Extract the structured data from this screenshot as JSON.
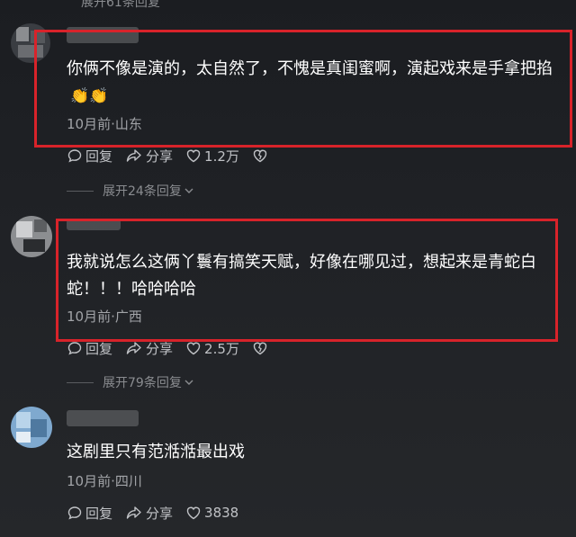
{
  "top_expand": {
    "label": "展开61条回复"
  },
  "comments": [
    {
      "text": "你俩不像是演的，太自然了，不愧是真闺蜜啊，演起戏来是手拿把掐",
      "emoji": "👏👏",
      "meta": "10月前·山东",
      "reply_label": "回复",
      "share_label": "分享",
      "likes": "1.2万",
      "expand_label": "展开24条回复"
    },
    {
      "text": "我就说怎么这俩丫鬟有搞笑天赋，好像在哪见过，想起来是青蛇白蛇！！！哈哈哈哈",
      "meta": "10月前·广西",
      "reply_label": "回复",
      "share_label": "分享",
      "likes": "2.5万",
      "expand_label": "展开79条回复"
    },
    {
      "text": "这剧里只有范湉湉最出戏",
      "meta": "10月前·四川",
      "reply_label": "回复",
      "share_label": "分享",
      "likes": "3838"
    }
  ],
  "colors": {
    "highlight": "#d8232a",
    "meta": "#a2a4a8",
    "background": "#202226"
  }
}
